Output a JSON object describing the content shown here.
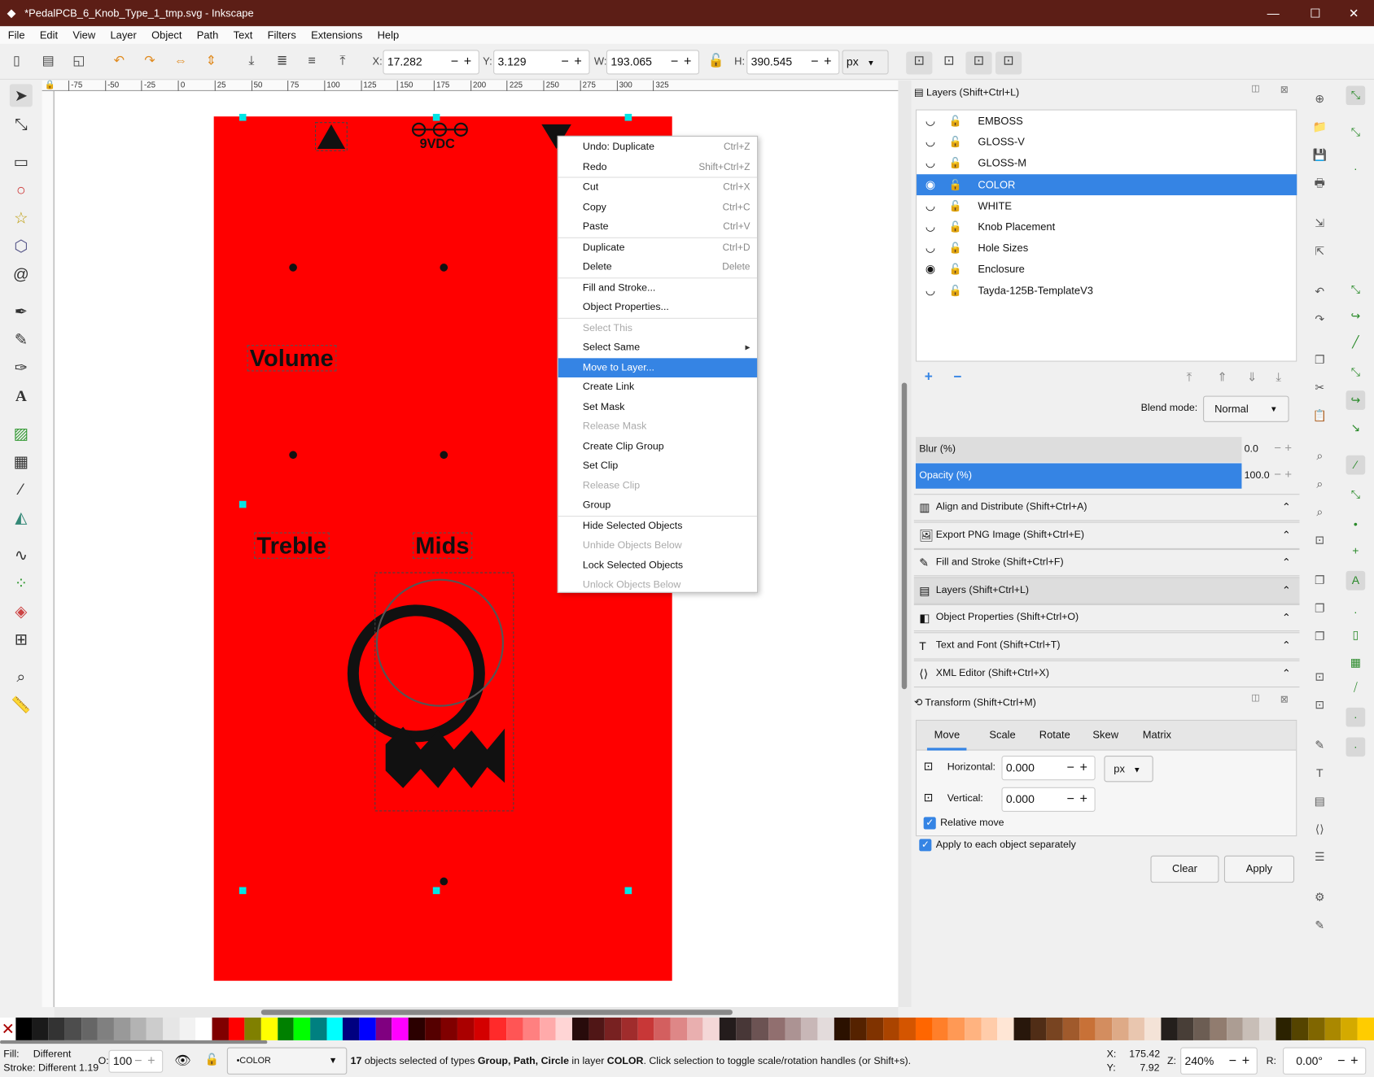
{
  "window": {
    "title": "*PedalPCB_6_Knob_Type_1_tmp.svg - Inkscape",
    "minimize": "—",
    "maximize": "☐",
    "close": "✕"
  },
  "menu": [
    "File",
    "Edit",
    "View",
    "Layer",
    "Object",
    "Path",
    "Text",
    "Filters",
    "Extensions",
    "Help"
  ],
  "toolbar": {
    "x_label": "X:",
    "x": "17.282",
    "y_label": "Y:",
    "y": "3.129",
    "w_label": "W:",
    "w": "193.065",
    "h_label": "H:",
    "h": "390.545",
    "unit": "px"
  },
  "ruler": {
    "ticks": [
      "-75",
      "-50",
      "-25",
      "0",
      "25",
      "50",
      "75",
      "100",
      "125",
      "150",
      "175",
      "200",
      "225",
      "250",
      "275",
      "300",
      "325"
    ]
  },
  "canvas": {
    "label_9vdc": "9VDC",
    "volume": "Volume",
    "treble": "Treble",
    "mids": "Mids"
  },
  "context_menu": [
    {
      "label": "Undo: Duplicate",
      "shortcut": "Ctrl+Z"
    },
    {
      "label": "Redo",
      "shortcut": "Shift+Ctrl+Z"
    },
    {
      "sep": true
    },
    {
      "label": "Cut",
      "shortcut": "Ctrl+X"
    },
    {
      "label": "Copy",
      "shortcut": "Ctrl+C"
    },
    {
      "label": "Paste",
      "shortcut": "Ctrl+V"
    },
    {
      "sep": true
    },
    {
      "label": "Duplicate",
      "shortcut": "Ctrl+D"
    },
    {
      "label": "Delete",
      "shortcut": "Delete"
    },
    {
      "sep": true
    },
    {
      "label": "Fill and Stroke..."
    },
    {
      "label": "Object Properties..."
    },
    {
      "sep": true
    },
    {
      "label": "Select This",
      "disabled": true
    },
    {
      "label": "Select Same",
      "submenu": "▸"
    },
    {
      "label": "Move to Layer...",
      "highlighted": true
    },
    {
      "label": "Create Link"
    },
    {
      "label": "Set Mask"
    },
    {
      "label": "Release Mask",
      "disabled": true
    },
    {
      "label": "Create Clip Group"
    },
    {
      "label": "Set Clip"
    },
    {
      "label": "Release Clip",
      "disabled": true
    },
    {
      "label": "Group"
    },
    {
      "sep": true
    },
    {
      "label": "Hide Selected Objects"
    },
    {
      "label": "Unhide Objects Below",
      "disabled": true
    },
    {
      "label": "Lock Selected Objects"
    },
    {
      "label": "Unlock Objects Below",
      "disabled": true
    }
  ],
  "layers_panel": {
    "title": "Layers (Shift+Ctrl+L)",
    "layers": [
      {
        "name": "EMBOSS",
        "visible": false
      },
      {
        "name": "GLOSS-V",
        "visible": false
      },
      {
        "name": "GLOSS-M",
        "visible": false
      },
      {
        "name": "COLOR",
        "visible": true,
        "selected": true
      },
      {
        "name": "WHITE",
        "visible": false
      },
      {
        "name": "Knob Placement",
        "visible": false
      },
      {
        "name": "Hole Sizes",
        "visible": false
      },
      {
        "name": "Enclosure",
        "visible": true
      },
      {
        "name": "Tayda-125B-TemplateV3",
        "visible": false
      }
    ],
    "blend_label": "Blend mode:",
    "blend": "Normal",
    "blur_label": "Blur (%)",
    "blur": "0.0",
    "opacity_label": "Opacity (%)",
    "opacity": "100.0"
  },
  "docked": [
    "Align and Distribute (Shift+Ctrl+A)",
    "Export PNG Image (Shift+Ctrl+E)",
    "Fill and Stroke (Shift+Ctrl+F)",
    "Layers (Shift+Ctrl+L)",
    "Object Properties (Shift+Ctrl+O)",
    "Text and Font (Shift+Ctrl+T)",
    "XML Editor (Shift+Ctrl+X)"
  ],
  "transform": {
    "title": "Transform (Shift+Ctrl+M)",
    "tabs": [
      "Move",
      "Scale",
      "Rotate",
      "Skew",
      "Matrix"
    ],
    "horizontal_label": "Horizontal:",
    "horizontal": "0.000",
    "vertical_label": "Vertical:",
    "vertical": "0.000",
    "unit": "px",
    "relative": "Relative move",
    "each": "Apply to each object separately",
    "clear": "Clear",
    "apply": "Apply"
  },
  "palette": [
    "#000000",
    "#1a1a1a",
    "#333333",
    "#4d4d4d",
    "#666666",
    "#808080",
    "#999999",
    "#b3b3b3",
    "#cccccc",
    "#e6e6e6",
    "#f2f2f2",
    "#ffffff",
    "#800000",
    "#ff0000",
    "#808000",
    "#ffff00",
    "#008000",
    "#00ff00",
    "#008080",
    "#00ffff",
    "#000080",
    "#0000ff",
    "#800080",
    "#ff00ff",
    "#2b0000",
    "#550000",
    "#800000",
    "#aa0000",
    "#d40000",
    "#ff2a2a",
    "#ff5555",
    "#ff8080",
    "#ffaaaa",
    "#ffd5d5",
    "#280b0b",
    "#501616",
    "#782121",
    "#a02c2c",
    "#c83737",
    "#d35f5f",
    "#de8787",
    "#e9afaf",
    "#f4d7d7",
    "#241c1c",
    "#483737",
    "#6c5353",
    "#916f6f",
    "#ac9393",
    "#c8b7b7",
    "#e3dbdb",
    "#2b1100",
    "#552200",
    "#803300",
    "#aa4400",
    "#d45500",
    "#ff6600",
    "#ff7f2a",
    "#ff9955",
    "#ffb380",
    "#ffccaa",
    "#ffe6d5",
    "#28170b",
    "#502d16",
    "#784421",
    "#a05a2c",
    "#c87137",
    "#d38d5f",
    "#deaa87",
    "#e9c6af",
    "#f4e3d7",
    "#241f1c",
    "#483e37",
    "#6c5d53",
    "#917c6f",
    "#ac9d93",
    "#c8beb7",
    "#e3dedb",
    "#2b2200",
    "#554400",
    "#806600",
    "#aa8800",
    "#d4aa00",
    "#ffcc00"
  ],
  "status": {
    "fill_label": "Fill:",
    "fill": "Different",
    "stroke_label": "Stroke:",
    "stroke": "Different",
    "stroke_width": "1.19",
    "opacity_label": "O:",
    "opacity": "100",
    "layer": "•COLOR",
    "message_pre": "17",
    "message_1": " objects selected of types ",
    "types": "Group, Path, Circle",
    "message_2": " in layer ",
    "layer_name": "COLOR",
    "message_3": ". Click selection to toggle scale/rotation handles (or Shift+s).",
    "x_label": "X:",
    "x": "175.42",
    "y_label": "Y:",
    "y": "7.92",
    "zoom_label": "Z:",
    "zoom": "240%",
    "rot_label": "R:",
    "rotation": "0.00°"
  }
}
